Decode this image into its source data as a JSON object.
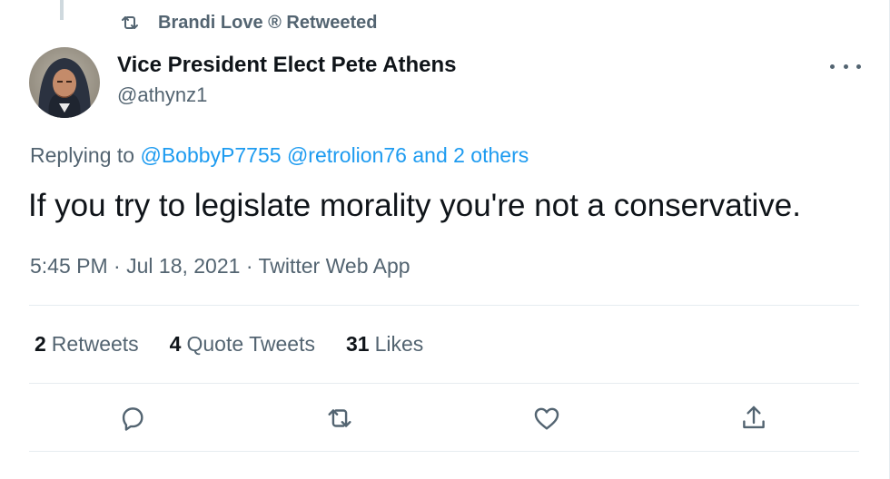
{
  "retweet_header": {
    "text": "Brandi Love ® Retweeted",
    "icon": "retweet-icon"
  },
  "author": {
    "name": "Vice President Elect Pete Athens",
    "handle": "@athynz1",
    "avatar": "user-avatar-photo"
  },
  "more_menu": {
    "icon": "more-dots-icon"
  },
  "reply": {
    "prefix": "Replying to",
    "mention_1": "@BobbyP7755",
    "mention_2": "@retrolion76",
    "others": "and 2 others"
  },
  "tweet": {
    "text": "If you try to legislate morality you're not a conservative."
  },
  "meta": {
    "time": "5:45 PM",
    "date": "Jul 18, 2021",
    "source": "Twitter Web App"
  },
  "stats": {
    "retweets": {
      "count": "2",
      "label": "Retweets"
    },
    "quotes": {
      "count": "4",
      "label": "Quote Tweets"
    },
    "likes": {
      "count": "31",
      "label": "Likes"
    }
  },
  "actions": [
    "reply-icon",
    "retweet-icon",
    "like-heart-icon",
    "share-icon"
  ],
  "colors": {
    "text": "#0f1419",
    "secondary": "#536471",
    "link": "#1d9bf0",
    "divider": "#e6ecf0"
  }
}
